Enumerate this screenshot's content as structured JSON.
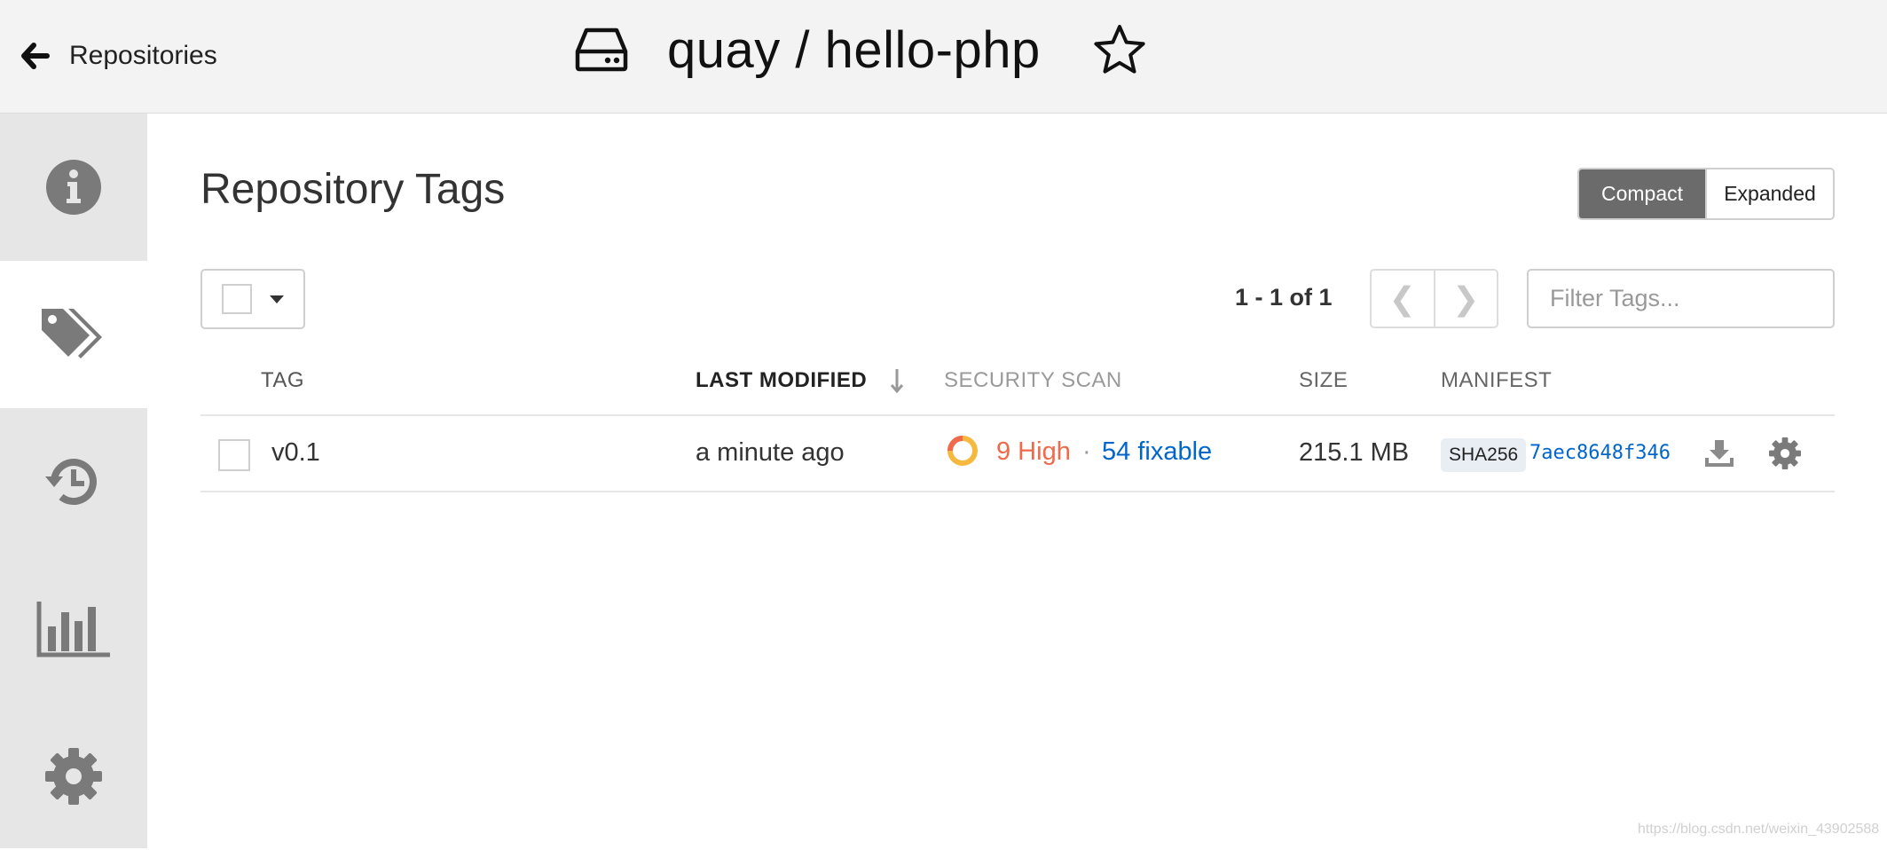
{
  "header": {
    "back_label": "Repositories",
    "repo_title": "quay / hello-php"
  },
  "sidebar": {
    "items": [
      {
        "name": "info-icon"
      },
      {
        "name": "tags-icon",
        "active": true
      },
      {
        "name": "history-icon"
      },
      {
        "name": "usage-chart-icon"
      },
      {
        "name": "settings-gear-icon"
      }
    ]
  },
  "main": {
    "title": "Repository Tags",
    "view_toggle": {
      "compact": "Compact",
      "expanded": "Expanded",
      "selected": "Compact"
    },
    "pagination": {
      "text": "1 - 1 of 1",
      "prev": "❮",
      "next": "❯"
    },
    "filter": {
      "placeholder": "Filter Tags..."
    }
  },
  "table": {
    "columns": {
      "tag": "TAG",
      "last_modified": "LAST MODIFIED",
      "security_scan": "SECURITY SCAN",
      "size": "SIZE",
      "manifest": "MANIFEST"
    },
    "rows": [
      {
        "tag": "v0.1",
        "last_modified": "a minute ago",
        "scan_high": "9 High",
        "scan_separator": "·",
        "scan_fixable": "54 fixable",
        "size": "215.1 MB",
        "manifest_algo": "SHA256",
        "manifest_digest": "7aec8648f346"
      }
    ]
  },
  "watermark": "https://blog.csdn.net/weixin_43902588",
  "colors": {
    "high_severity": "#f0694a",
    "link": "#0066cc",
    "active_toggle": "#6b6b6b",
    "sidebar_bg": "#e6e6e6"
  }
}
